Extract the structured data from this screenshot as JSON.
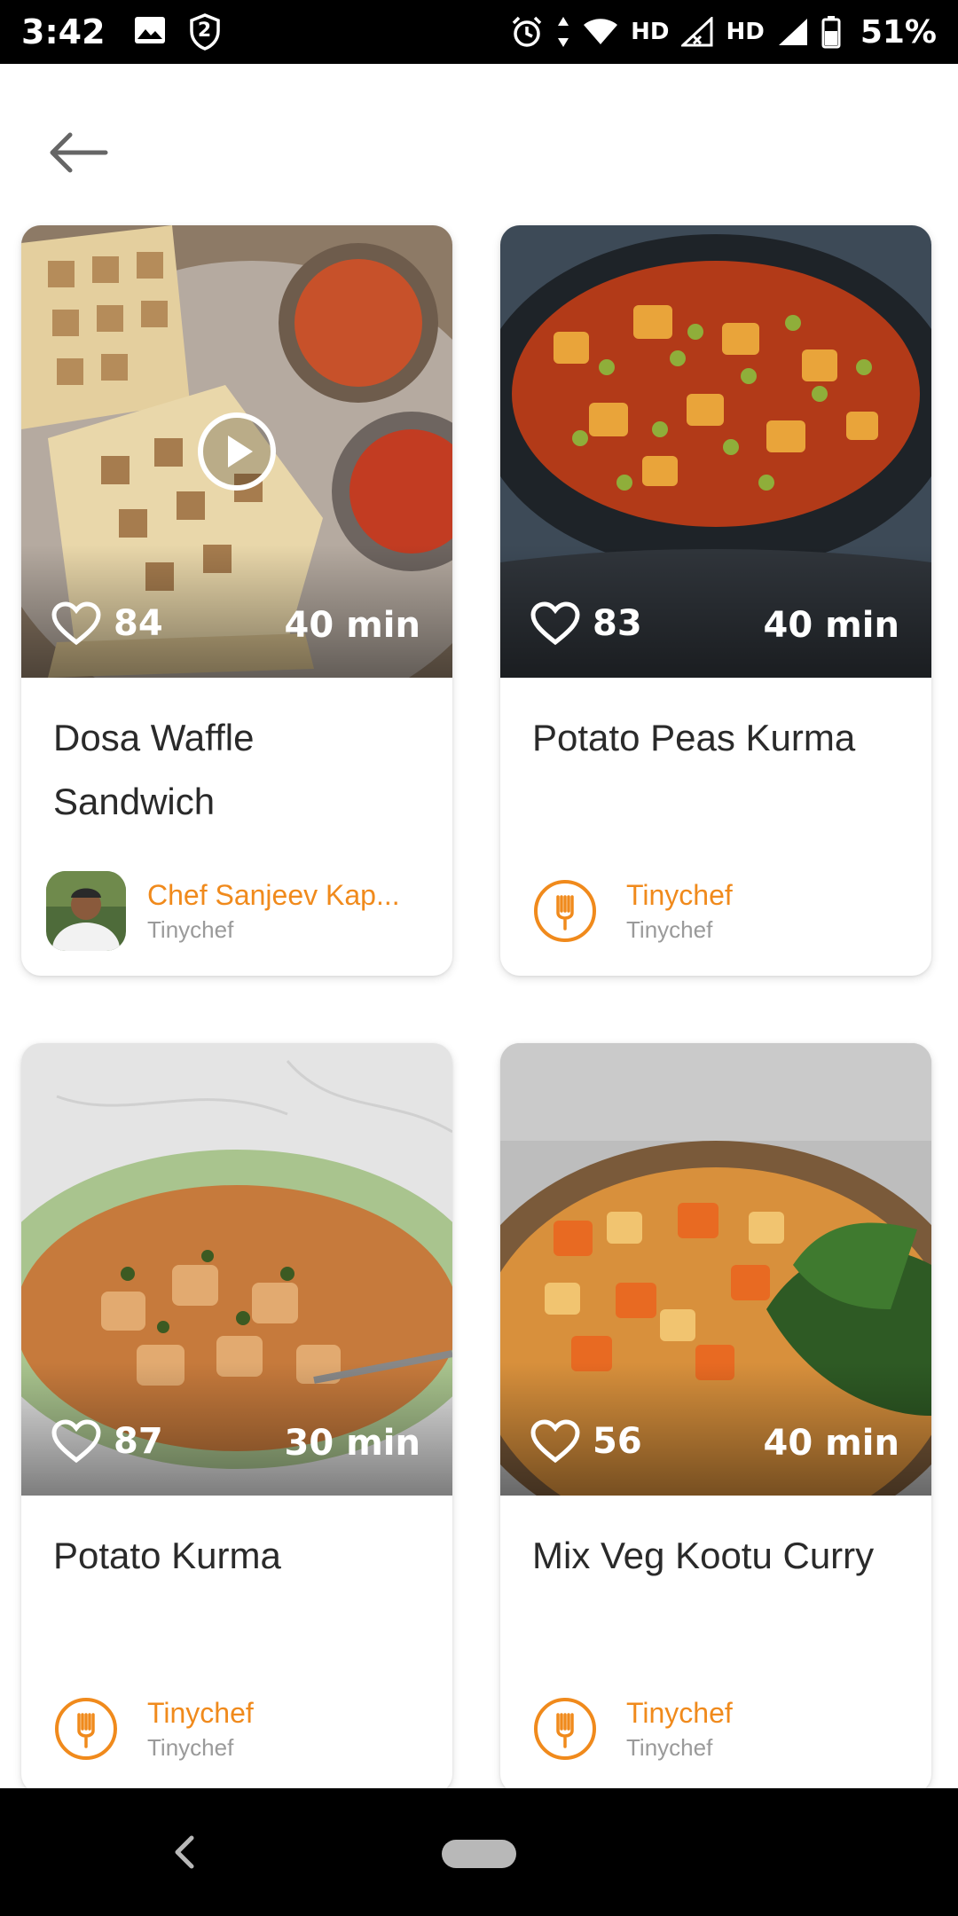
{
  "status_bar": {
    "time": "3:42",
    "notification_badge": "2",
    "hd_label_1": "HD",
    "hd_label_2": "HD",
    "battery": "51%"
  },
  "recipes": [
    {
      "title": "Dosa Waffle Sandwich",
      "likes": "84",
      "time": "40 min",
      "has_video": true,
      "chef_name": "Chef Sanjeev Kap...",
      "chef_sub": "Tinychef",
      "chef_avatar": "chef-photo",
      "image_icon": "dosa-waffle-photo"
    },
    {
      "title": "Potato Peas Kurma",
      "likes": "83",
      "time": "40 min",
      "has_video": false,
      "chef_name": "Tinychef",
      "chef_sub": "Tinychef",
      "chef_avatar": "tinychef-logo",
      "image_icon": "potato-peas-kurma-photo"
    },
    {
      "title": "Potato Kurma",
      "likes": "87",
      "time": "30 min",
      "has_video": false,
      "chef_name": "Tinychef",
      "chef_sub": "Tinychef",
      "chef_avatar": "tinychef-logo",
      "image_icon": "potato-kurma-photo"
    },
    {
      "title": "Mix Veg Kootu Curry",
      "likes": "56",
      "time": "40 min",
      "has_video": false,
      "chef_name": "Tinychef",
      "chef_sub": "Tinychef",
      "chef_avatar": "tinychef-logo",
      "image_icon": "mix-veg-kootu-photo"
    }
  ],
  "colors": {
    "accent": "#f08a1c",
    "subtext": "#9a9a9a",
    "title": "#2a2a2a"
  }
}
